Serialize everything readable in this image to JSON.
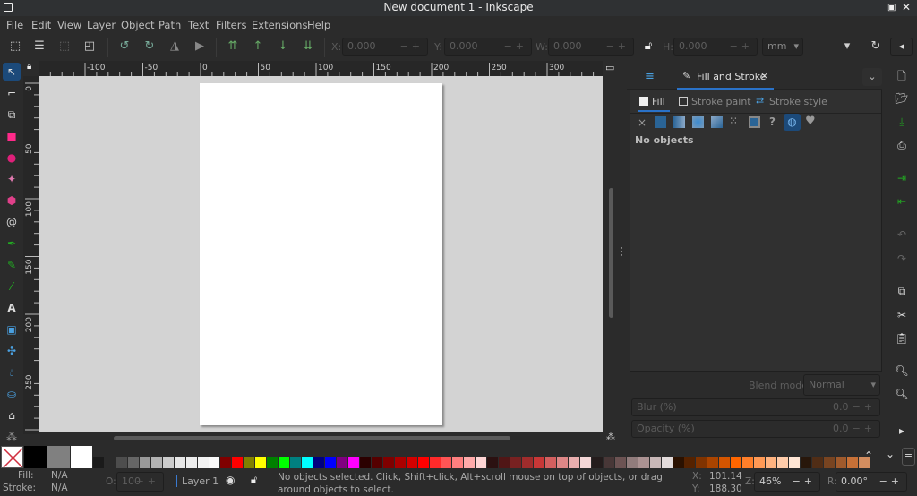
{
  "window": {
    "title": "New document 1 - Inkscape"
  },
  "menu": [
    "File",
    "Edit",
    "View",
    "Layer",
    "Object",
    "Path",
    "Text",
    "Filters",
    "Extensions",
    "Help"
  ],
  "toolbar": {
    "x_label": "X:",
    "x_value": "0.000",
    "y_label": "Y:",
    "y_value": "0.000",
    "w_label": "W:",
    "w_value": "0.000",
    "h_label": "H:",
    "h_value": "0.000",
    "unit": "mm",
    "stepper": "−+"
  },
  "ruler": {
    "h_ticks": [
      "-100",
      "-50",
      "0",
      "50",
      "100",
      "150",
      "200",
      "250",
      "300"
    ],
    "v_ticks": [
      "0",
      "50",
      "100",
      "150",
      "200",
      "250"
    ]
  },
  "dock": {
    "tab_label": "Fill and Stroke",
    "close": "×",
    "subtabs": [
      "Fill",
      "Stroke paint",
      "Stroke style"
    ],
    "paint_types": [
      "×",
      "■",
      "▥",
      "◉",
      "◩",
      "⁙",
      "▣",
      "?",
      "◍",
      "♥"
    ],
    "status": "No objects",
    "blend_label": "Blend mode:",
    "blend_value": "Normal",
    "blur_label": "Blur (%)",
    "blur_value": "0.0",
    "opacity_label": "Opacity (%)",
    "opacity_value": "0.0"
  },
  "palette": {
    "swatches": [
      "#1a1a1a",
      "#2b2b2b",
      "#4d4d4d",
      "#666666",
      "#999999",
      "#b3b3b3",
      "#cccccc",
      "#e6e6e6",
      "#ececec",
      "#f2f2f2",
      "#f9f9f9",
      "#800000",
      "#ff0000",
      "#808000",
      "#ffff00",
      "#008000",
      "#00ff00",
      "#008080",
      "#00ffff",
      "#000080",
      "#0000ff",
      "#800080",
      "#ff00ff",
      "#2b0000",
      "#550000",
      "#800000",
      "#aa0000",
      "#d40000",
      "#ff0000",
      "#ff2a2a",
      "#ff5555",
      "#ff8080",
      "#ffaaaa",
      "#ffd5d5",
      "#2b1111",
      "#501616",
      "#782121",
      "#a02c2c",
      "#c83737",
      "#d35f5f",
      "#de8787",
      "#e9afaf",
      "#f4d7d7",
      "#241c1c",
      "#483737",
      "#6c5353",
      "#917c7c",
      "#ac9393",
      "#c8b7b7",
      "#e3dbdb",
      "#2b1100",
      "#552200",
      "#803300",
      "#aa4400",
      "#d45500",
      "#ff6600",
      "#ff7f2a",
      "#ff9955",
      "#ffb380",
      "#ffccaa",
      "#ffe6d5",
      "#28170b",
      "#502d16",
      "#784421",
      "#a05a2c",
      "#c87137",
      "#d38d5f"
    ]
  },
  "status": {
    "fill_label": "Fill:",
    "fill_value": "N/A",
    "stroke_label": "Stroke:",
    "stroke_value": "N/A",
    "o_label": "O:",
    "o_value": "100",
    "layer": "Layer 1",
    "message": "No objects selected. Click, Shift+click, Alt+scroll mouse on top of objects, or drag around objects to select.",
    "x_label": "X:",
    "x_value": "101.14",
    "y_label": "Y:",
    "y_value": "188.30",
    "z_label": "Z:",
    "zoom": "46%",
    "r_label": "R:",
    "rotation": "0.00°"
  }
}
